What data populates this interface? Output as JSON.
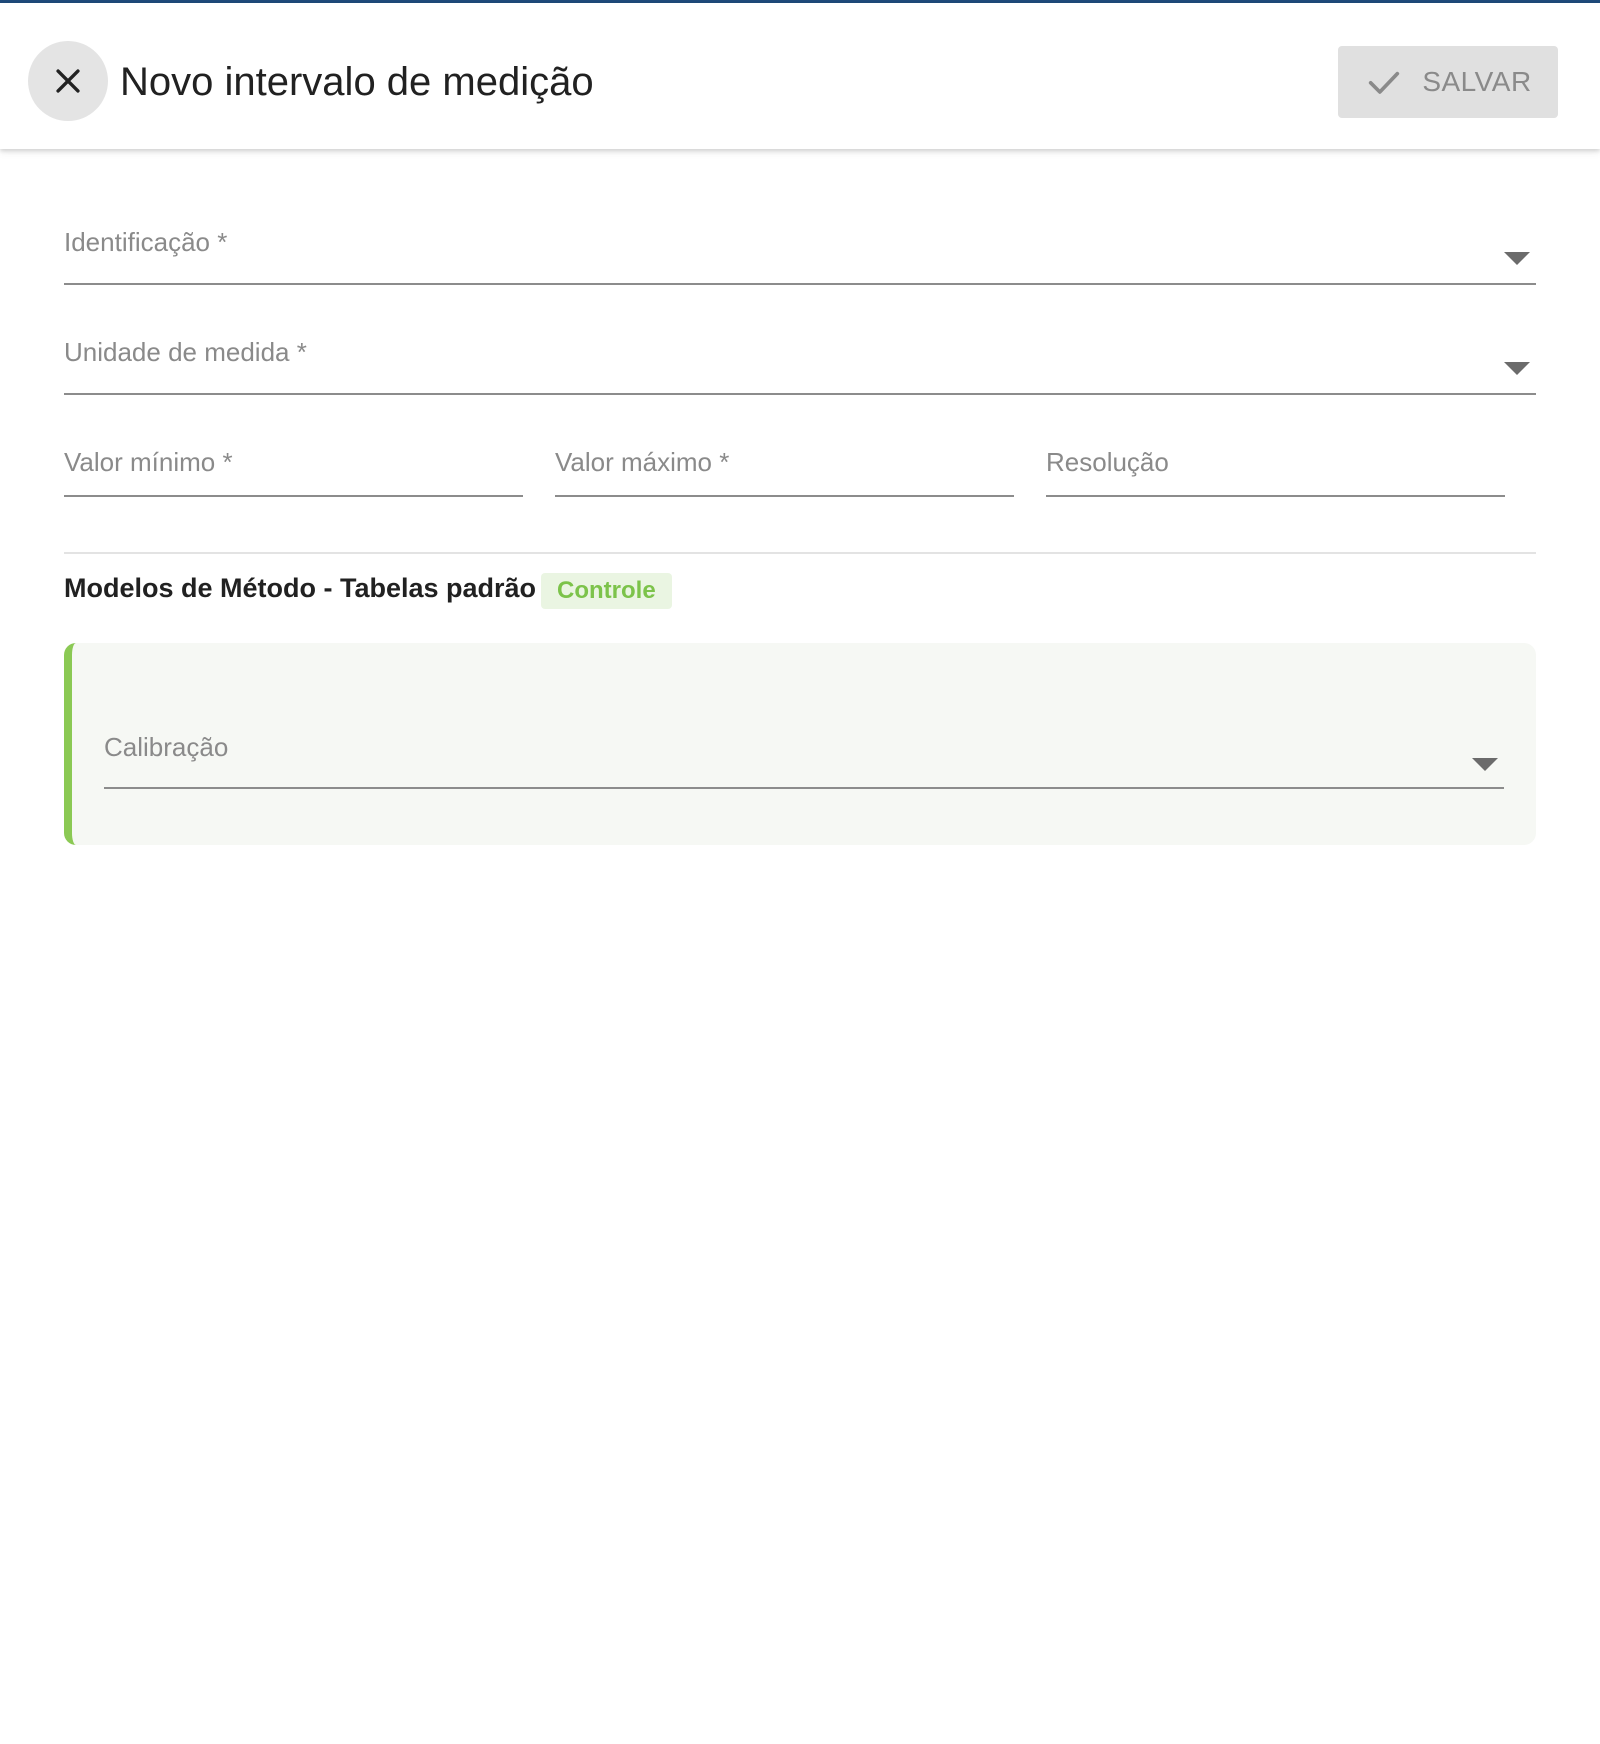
{
  "header": {
    "title": "Novo intervalo de medição",
    "save_label": "SALVAR"
  },
  "form": {
    "identification": {
      "label": "Identificação *",
      "value": ""
    },
    "unit": {
      "label": "Unidade de medida *",
      "value": ""
    },
    "min_value": {
      "label": "Valor mínimo *",
      "value": ""
    },
    "max_value": {
      "label": "Valor máximo *",
      "value": ""
    },
    "resolution": {
      "label": "Resolução",
      "value": ""
    }
  },
  "section": {
    "title": "Modelos de Método - Tabelas padrão",
    "badge": "Controle",
    "calibration": {
      "label": "Calibração",
      "value": ""
    }
  },
  "colors": {
    "accent_green": "#8bc954",
    "badge_text": "#7cc34a",
    "badge_bg": "#eaf5e2",
    "panel_bg": "#f6f8f4",
    "save_button_bg": "#e0e0e0",
    "top_border": "#1f4a7a"
  },
  "icons": {
    "close": "close-icon",
    "save": "check-icon",
    "dropdown": "caret-down-icon"
  }
}
